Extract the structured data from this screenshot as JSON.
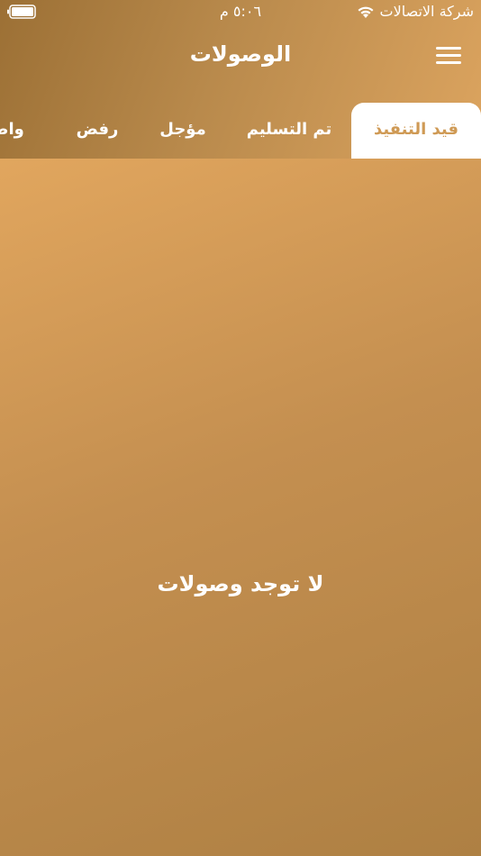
{
  "status_bar": {
    "carrier": "شركة الاتصالات",
    "time": "٥:٠٦ م",
    "wifi_icon": "wifi-icon",
    "battery_icon": "battery-icon"
  },
  "header": {
    "title": "الوصولات",
    "menu_icon": "hamburger-menu-icon"
  },
  "tabs": [
    {
      "label": "قيد التنفيذ",
      "active": true
    },
    {
      "label": "تم التسليم",
      "active": false
    },
    {
      "label": "مؤجل",
      "active": false
    },
    {
      "label": "رفض",
      "active": false
    },
    {
      "label": "واصل",
      "active": false
    }
  ],
  "main": {
    "empty_message": "لا توجد وصولات"
  },
  "colors": {
    "accent": "#cf9a55",
    "header_gradient_start": "#9c7035",
    "header_gradient_end": "#dca45f",
    "content_gradient_start": "#e1a65e",
    "content_gradient_end": "#ae8043",
    "active_tab_bg": "#ffffff"
  }
}
